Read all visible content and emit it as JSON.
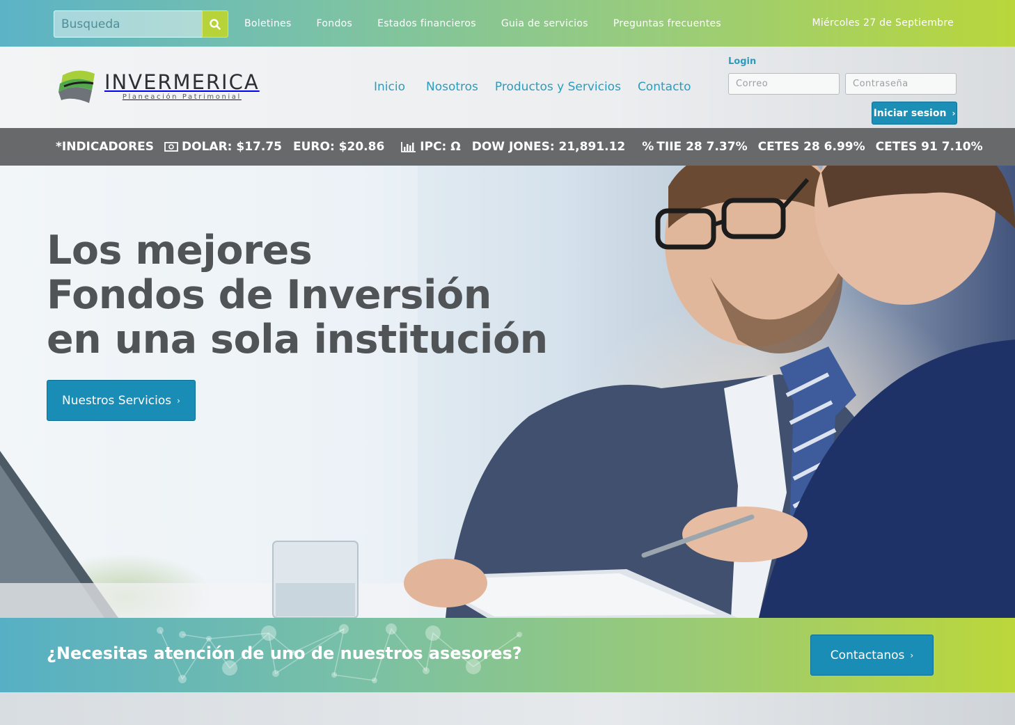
{
  "topbar": {
    "search_placeholder": "Busqueda",
    "links": [
      "Boletines",
      "Fondos",
      "Estados financieros",
      "Guia de servicios",
      "Preguntas frecuentes"
    ],
    "date": "Miércoles 27 de Septiembre"
  },
  "header": {
    "logo_name": "INVERMERICA",
    "logo_tagline": "Planeación Patrimonial",
    "nav": [
      "Inicio",
      "Nosotros",
      "Productos y Servicios",
      "Contacto"
    ],
    "login": {
      "label": "Login",
      "email_placeholder": "Correo",
      "password_placeholder": "Contraseña",
      "button": "Iniciar sesion"
    }
  },
  "indicators": {
    "title": "*INDICADORES",
    "dolar": "DOLAR: $17.75",
    "euro": "EURO: $20.86",
    "ipc": "IPC: Ω",
    "dow": "DOW JONES: 21,891.12",
    "tiie": "TIIE 28 7.37%",
    "cetes28": "CETES 28 6.99%",
    "cetes91": "CETES 91 7.10%"
  },
  "hero": {
    "title_lines": [
      "Los mejores",
      "Fondos de Inversión",
      "en una sola institución"
    ],
    "button": "Nuestros Servicios"
  },
  "cta": {
    "text": "¿Necesitas atención de uno de nuestros asesores?",
    "button": "Contactanos"
  },
  "colors": {
    "accent_blue": "#1a8db6",
    "nav_blue": "#2b9cbd",
    "lime": "#b6d43a",
    "teal": "#5cb3c6",
    "indicator_gray": "#67696b"
  }
}
